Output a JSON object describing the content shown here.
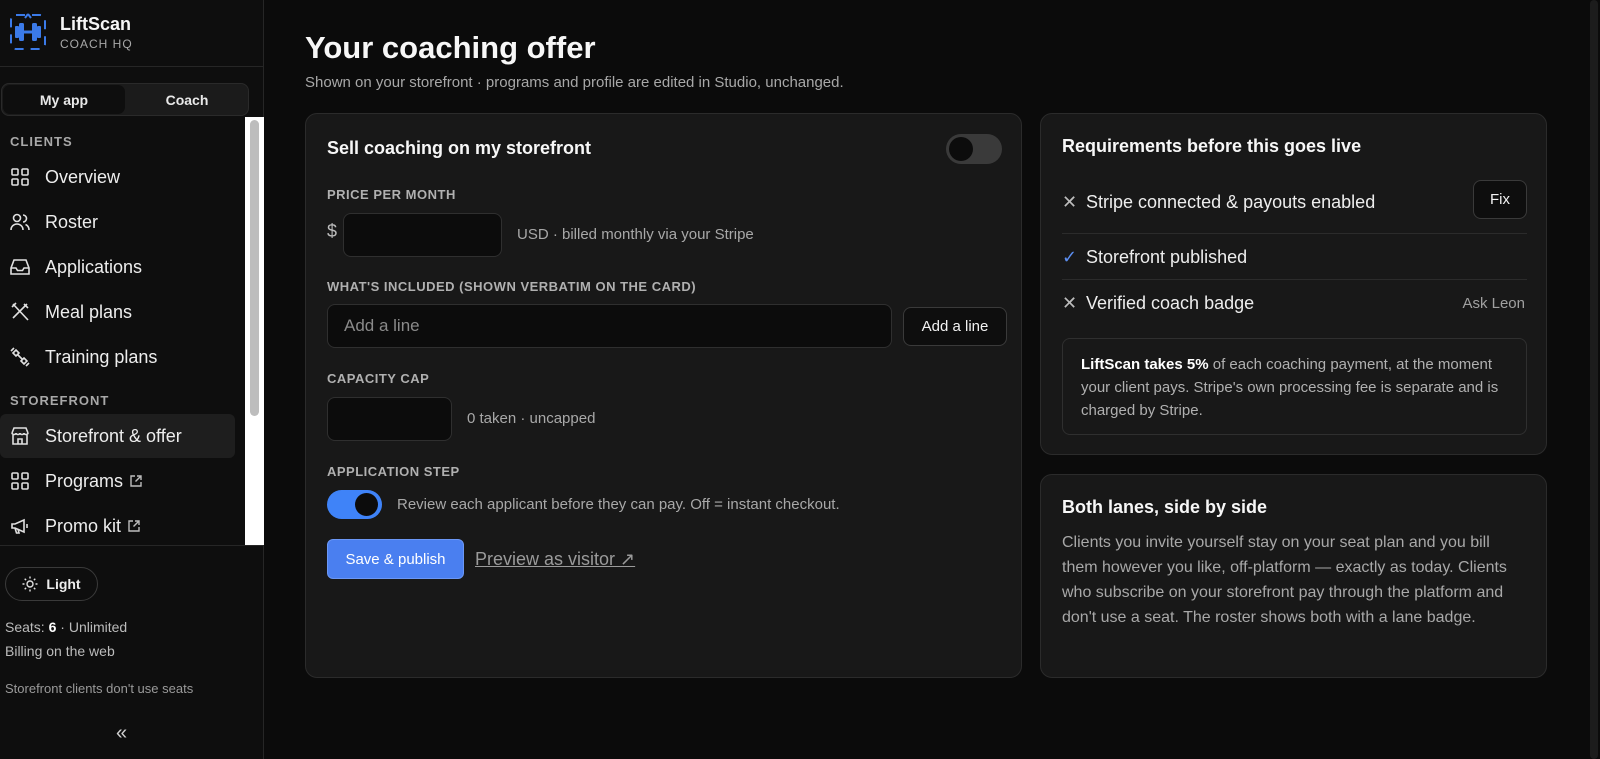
{
  "brand": {
    "name": "LiftScan",
    "sub": "COACH HQ"
  },
  "mode_switch": {
    "left": "My app",
    "right": "Coach"
  },
  "nav": {
    "clients_section": "CLIENTS",
    "storefront_section": "STOREFRONT",
    "items": [
      {
        "label": "Overview",
        "icon": "grid-icon"
      },
      {
        "label": "Roster",
        "icon": "users-icon"
      },
      {
        "label": "Applications",
        "icon": "inbox-icon"
      },
      {
        "label": "Meal plans",
        "icon": "utensils-icon"
      },
      {
        "label": "Training plans",
        "icon": "dumbbell-icon"
      },
      {
        "label": "Storefront & offer",
        "icon": "store-icon",
        "active": true
      },
      {
        "label": "Programs",
        "icon": "grid-icon",
        "external": true
      },
      {
        "label": "Promo kit",
        "icon": "megaphone-icon",
        "external": true
      }
    ]
  },
  "sidebar_footer": {
    "theme_label": "Light",
    "seats_prefix": "Seats: ",
    "seats_count": "6",
    "seats_suffix": " · Unlimited",
    "billing": "Billing on the web",
    "storefront_note": "Storefront clients don't use seats",
    "collapse_glyph": "«"
  },
  "page": {
    "title": "Your coaching offer",
    "subtitle": "Shown on your storefront · programs and profile are edited in Studio, unchanged."
  },
  "offer_card": {
    "title": "Sell coaching on my storefront",
    "sell_toggle_on": false,
    "price": {
      "label": "PRICE PER MONTH",
      "currency": "$",
      "value": "",
      "hint": "USD · billed monthly via your Stripe"
    },
    "included": {
      "label": "WHAT'S INCLUDED (SHOWN VERBATIM ON THE CARD)",
      "placeholder": "Add a line",
      "add_button": "Add a line"
    },
    "capacity": {
      "label": "CAPACITY CAP",
      "value": "",
      "hint": "0 taken · uncapped"
    },
    "application": {
      "label": "APPLICATION STEP",
      "toggle_on": true,
      "text": "Review each applicant before they can pay. Off = instant checkout."
    },
    "save_button": "Save & publish",
    "preview_link": "Preview as visitor ↗"
  },
  "requirements": {
    "title": "Requirements before this goes live",
    "items": [
      {
        "status": "✕",
        "label": "Stripe connected & payouts enabled",
        "action": "Fix"
      },
      {
        "status": "✓",
        "label": "Storefront published"
      },
      {
        "status": "✕",
        "label": "Verified coach badge",
        "aside": "Ask Leon"
      }
    ],
    "fee_bold": "LiftScan takes 5%",
    "fee_rest": " of each coaching payment, at the moment your client pays. Stripe's own processing fee is separate and is charged by Stripe."
  },
  "lanes": {
    "title": "Both lanes, side by side",
    "text": "Clients you invite yourself stay on your seat plan and you bill them however you like, off-platform — exactly as today. Clients who subscribe on your storefront pay through the platform and don't use a seat. The roster shows both with a lane badge."
  },
  "colors": {
    "accent": "#4a7ff0",
    "check": "#5b8def",
    "background": "#0b0b0b",
    "card": "#181818"
  }
}
